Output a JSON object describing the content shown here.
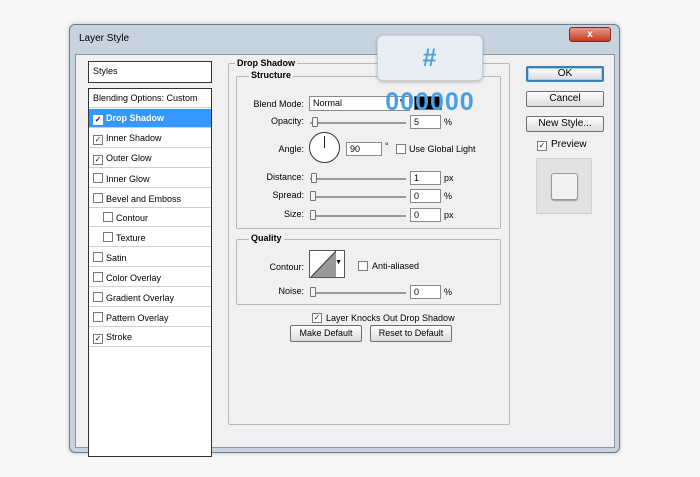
{
  "window": {
    "title": "Layer Style",
    "close_label": "x"
  },
  "hex_badge": "# 000000",
  "styles_list": {
    "header": "Styles",
    "items": [
      {
        "label": "Blending Options: Custom",
        "checkbox": false,
        "checked": false,
        "selected": false,
        "indent": false
      },
      {
        "label": "Drop Shadow",
        "checkbox": true,
        "checked": true,
        "selected": true,
        "indent": false
      },
      {
        "label": "Inner Shadow",
        "checkbox": true,
        "checked": true,
        "selected": false,
        "indent": false
      },
      {
        "label": "Outer Glow",
        "checkbox": true,
        "checked": true,
        "selected": false,
        "indent": false
      },
      {
        "label": "Inner Glow",
        "checkbox": true,
        "checked": false,
        "selected": false,
        "indent": false
      },
      {
        "label": "Bevel and Emboss",
        "checkbox": true,
        "checked": false,
        "selected": false,
        "indent": false
      },
      {
        "label": "Contour",
        "checkbox": true,
        "checked": false,
        "selected": false,
        "indent": true
      },
      {
        "label": "Texture",
        "checkbox": true,
        "checked": false,
        "selected": false,
        "indent": true
      },
      {
        "label": "Satin",
        "checkbox": true,
        "checked": false,
        "selected": false,
        "indent": false
      },
      {
        "label": "Color Overlay",
        "checkbox": true,
        "checked": false,
        "selected": false,
        "indent": false
      },
      {
        "label": "Gradient Overlay",
        "checkbox": true,
        "checked": false,
        "selected": false,
        "indent": false
      },
      {
        "label": "Pattern Overlay",
        "checkbox": true,
        "checked": false,
        "selected": false,
        "indent": false
      },
      {
        "label": "Stroke",
        "checkbox": true,
        "checked": true,
        "selected": false,
        "indent": false
      }
    ]
  },
  "drop_shadow": {
    "section_title": "Drop Shadow",
    "structure": {
      "title": "Structure",
      "blend_mode_label": "Blend Mode:",
      "blend_mode_value": "Normal",
      "shadow_color": "#000000",
      "opacity_label": "Opacity:",
      "opacity_value": "5",
      "opacity_unit": "%",
      "angle_label": "Angle:",
      "angle_value": "90",
      "angle_unit": "°",
      "global_light_label": "Use Global Light",
      "global_light_checked": false,
      "distance_label": "Distance:",
      "distance_value": "1",
      "distance_unit": "px",
      "spread_label": "Spread:",
      "spread_value": "0",
      "spread_unit": "%",
      "size_label": "Size:",
      "size_value": "0",
      "size_unit": "px"
    },
    "quality": {
      "title": "Quality",
      "contour_label": "Contour:",
      "anti_aliased_label": "Anti-aliased",
      "anti_aliased_checked": false,
      "noise_label": "Noise:",
      "noise_value": "0",
      "noise_unit": "%"
    },
    "knockout_label": "Layer Knocks Out Drop Shadow",
    "knockout_checked": true,
    "make_default_label": "Make Default",
    "reset_default_label": "Reset to Default"
  },
  "buttons": {
    "ok": "OK",
    "cancel": "Cancel",
    "new_style": "New Style..."
  },
  "preview": {
    "label": "Preview",
    "checked": true
  }
}
